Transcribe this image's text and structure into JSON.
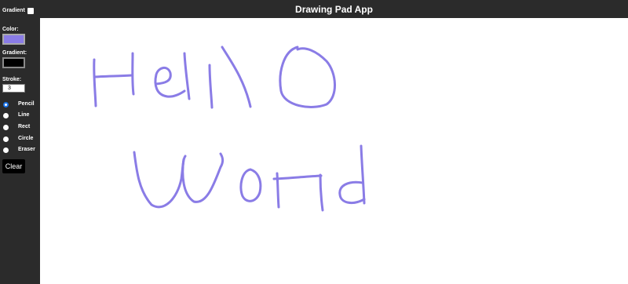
{
  "header": {
    "title": "Drawing Pad App"
  },
  "sidebar": {
    "gradient_toggle_label": "Gradient",
    "gradient_enabled": false,
    "color_label": "Color:",
    "color_value": "#8a7ce6",
    "gradient_label": "Gradient:",
    "gradient_value": "#000000",
    "stroke_label": "Stroke:",
    "stroke_value": "3",
    "tools": [
      {
        "label": "Pencil",
        "selected": true
      },
      {
        "label": "Line",
        "selected": false
      },
      {
        "label": "Rect",
        "selected": false
      },
      {
        "label": "Circle",
        "selected": false
      },
      {
        "label": "Eraser",
        "selected": false
      }
    ],
    "clear_label": "Clear"
  },
  "canvas": {
    "stroke_color": "#8a7ce6",
    "stroke_width": 3
  },
  "colors": {
    "chrome": "#2b2b2b",
    "canvas": "#ffffff",
    "radio_accent": "#1a73e8"
  }
}
